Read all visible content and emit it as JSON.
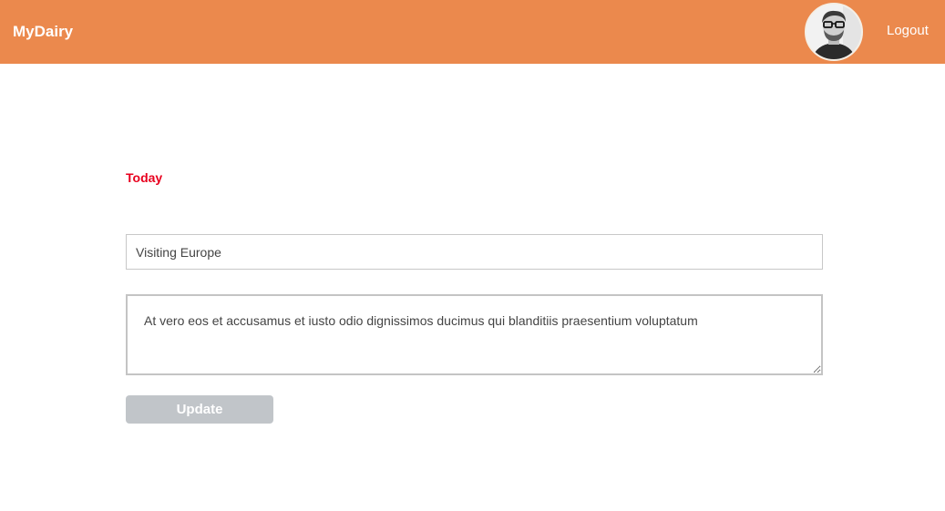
{
  "header": {
    "brand": "MyDairy",
    "logout_label": "Logout",
    "accent_color": "#eb894d"
  },
  "avatar": {
    "icon": "user-avatar-photo"
  },
  "entry": {
    "date_label": "Today",
    "title_value": "Visiting Europe",
    "body_value": "At vero eos et accusamus et iusto odio dignissimos ducimus qui blanditiis praesentium voluptatum",
    "update_label": "Update"
  }
}
